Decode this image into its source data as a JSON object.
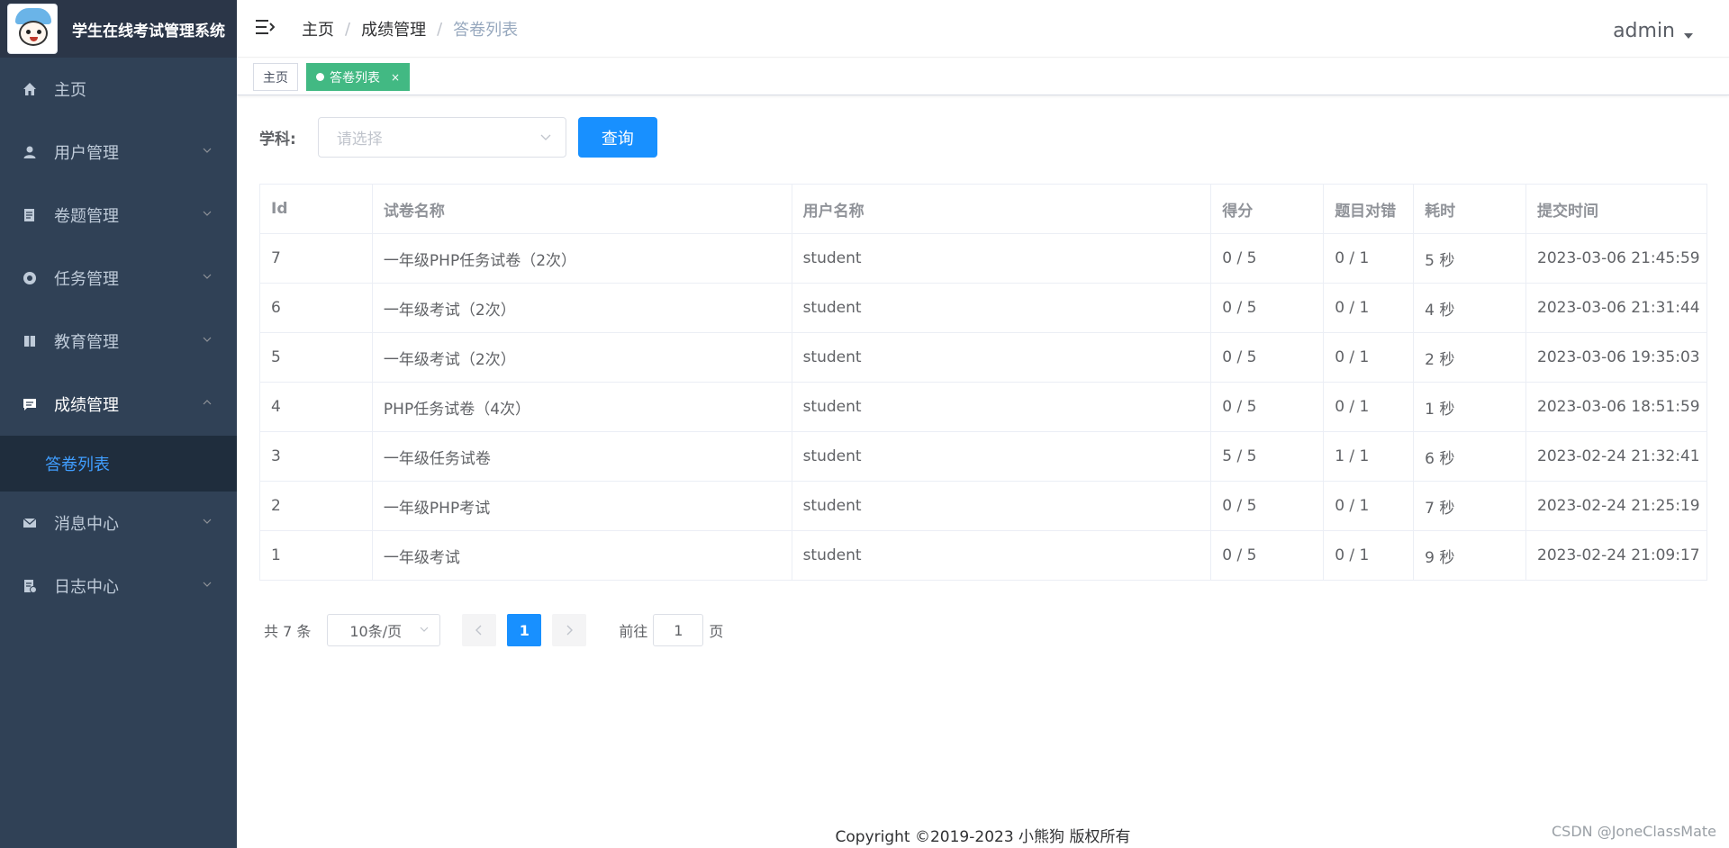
{
  "app": {
    "title": "学生在线考试管理系统"
  },
  "sidebar": {
    "items": [
      {
        "label": "主页",
        "icon": "home-icon",
        "expandable": false
      },
      {
        "label": "用户管理",
        "icon": "user-icon",
        "expandable": true
      },
      {
        "label": "卷题管理",
        "icon": "paper-icon",
        "expandable": true
      },
      {
        "label": "任务管理",
        "icon": "task-icon",
        "expandable": true
      },
      {
        "label": "教育管理",
        "icon": "book-icon",
        "expandable": true
      },
      {
        "label": "成绩管理",
        "icon": "chat-icon",
        "expandable": true,
        "open": true
      },
      {
        "label": "消息中心",
        "icon": "mail-icon",
        "expandable": true
      },
      {
        "label": "日志中心",
        "icon": "log-icon",
        "expandable": true
      }
    ],
    "active_sub": "答卷列表"
  },
  "header": {
    "breadcrumb": [
      "主页",
      "成绩管理",
      "答卷列表"
    ],
    "user": "admin"
  },
  "tags": {
    "home": "主页",
    "active": "答卷列表",
    "close": "×"
  },
  "filter": {
    "label": "学科:",
    "placeholder": "请选择",
    "query_button": "查询"
  },
  "table": {
    "columns": [
      "Id",
      "试卷名称",
      "用户名称",
      "得分",
      "题目对错",
      "耗时",
      "提交时间"
    ],
    "rows": [
      [
        "7",
        "一年级PHP任务试卷（2次）",
        "student",
        "0 / 5",
        "0 / 1",
        "5 秒",
        "2023-03-06 21:45:59"
      ],
      [
        "6",
        "一年级考试（2次）",
        "student",
        "0 / 5",
        "0 / 1",
        "4 秒",
        "2023-03-06 21:31:44"
      ],
      [
        "5",
        "一年级考试（2次）",
        "student",
        "0 / 5",
        "0 / 1",
        "2 秒",
        "2023-03-06 19:35:03"
      ],
      [
        "4",
        "PHP任务试卷（4次）",
        "student",
        "0 / 5",
        "0 / 1",
        "1 秒",
        "2023-03-06 18:51:59"
      ],
      [
        "3",
        "一年级任务试卷",
        "student",
        "5 / 5",
        "1 / 1",
        "6 秒",
        "2023-02-24 21:32:41"
      ],
      [
        "2",
        "一年级PHP考试",
        "student",
        "0 / 5",
        "0 / 1",
        "7 秒",
        "2023-02-24 21:25:19"
      ],
      [
        "1",
        "一年级考试",
        "student",
        "0 / 5",
        "0 / 1",
        "9 秒",
        "2023-02-24 21:09:17"
      ]
    ]
  },
  "pagination": {
    "total": "共 7 条",
    "page_size": "10条/页",
    "current_page": "1",
    "goto_prefix": "前往",
    "goto_value": "1",
    "goto_suffix": "页"
  },
  "footer": {
    "copyright": "Copyright ©2019-2023 小熊狗 版权所有"
  },
  "watermark": "CSDN @JoneClassMate",
  "colors": {
    "sidebar_bg": "#304156",
    "accent": "#1890ff",
    "tag_active": "#42b983",
    "submenu_active": "#409eff"
  }
}
